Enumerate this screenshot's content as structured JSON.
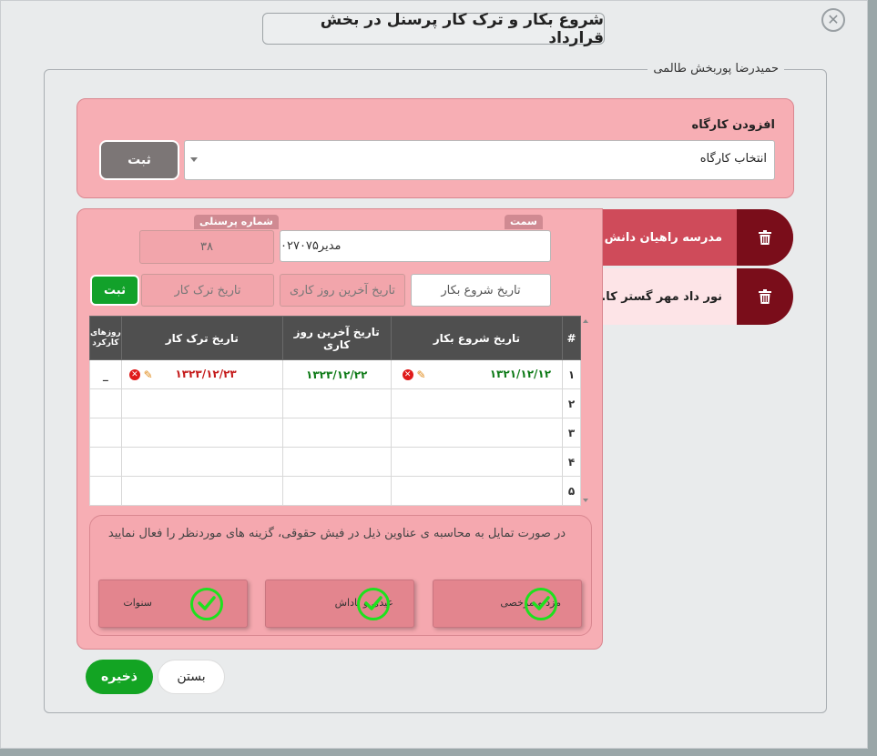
{
  "dialog": {
    "title": "شروع بکار و ترک کار پرسنل در بخش قرارداد",
    "close_symbol": "✕",
    "employee_name": "حمیدرضا پوربخش طالمی"
  },
  "add_workshop": {
    "label": "افزودن کارگاه",
    "select_value": "انتخاب کارگاه",
    "submit_label": "ثبت"
  },
  "workshops": [
    {
      "name": "مدرسه راهیان دانش",
      "active": true
    },
    {
      "name": "نور داد مهر گستر کا...",
      "active": false
    }
  ],
  "form": {
    "position_label": "سمت",
    "position_value": "مدیر۰۲۷۰۷۵",
    "personnel_no_label": "شماره پرسنلی",
    "personnel_no_value": "۳۸",
    "start_date_placeholder": "تاریخ شروع بکار",
    "last_day_placeholder": "تاریخ آخرین روز کاری",
    "leave_date_placeholder": "تاریخ ترک کار",
    "submit_label": "ثبت"
  },
  "table": {
    "headers": [
      "#",
      "تاریخ شروع بکار",
      "تاریخ آخرین روز کاری",
      "تاریخ ترک کار",
      "روزهای کارکرد"
    ],
    "rows": [
      {
        "idx": "۱",
        "start": "۱۳۲۱/۱۲/۱۲",
        "last": "۱۳۲۳/۱۲/۲۲",
        "leave": "۱۳۲۳/۱۲/۲۳",
        "days": "_"
      },
      {
        "idx": "۲",
        "start": "",
        "last": "",
        "leave": "",
        "days": ""
      },
      {
        "idx": "۳",
        "start": "",
        "last": "",
        "leave": "",
        "days": ""
      },
      {
        "idx": "۴",
        "start": "",
        "last": "",
        "leave": "",
        "days": ""
      },
      {
        "idx": "۵",
        "start": "",
        "last": "",
        "leave": "",
        "days": ""
      }
    ]
  },
  "calc": {
    "message": "در صورت تمایل به محاسبه ی عناوین ذیل در فیش حقوقی، گزینه های موردنظر را فعال نمایید",
    "options": [
      {
        "label": "مزد و مرخصی",
        "checked": true
      },
      {
        "label": "عیدی و پاداش",
        "checked": true
      },
      {
        "label": "سنوات",
        "checked": true
      }
    ]
  },
  "footer": {
    "save_label": "ذخیره",
    "close_label": "بستن"
  },
  "colors": {
    "panel_pink": "#f7aeb4",
    "tab_active": "#cf4b5a",
    "tab_trash": "#7a0d1a",
    "green": "#13a423"
  }
}
